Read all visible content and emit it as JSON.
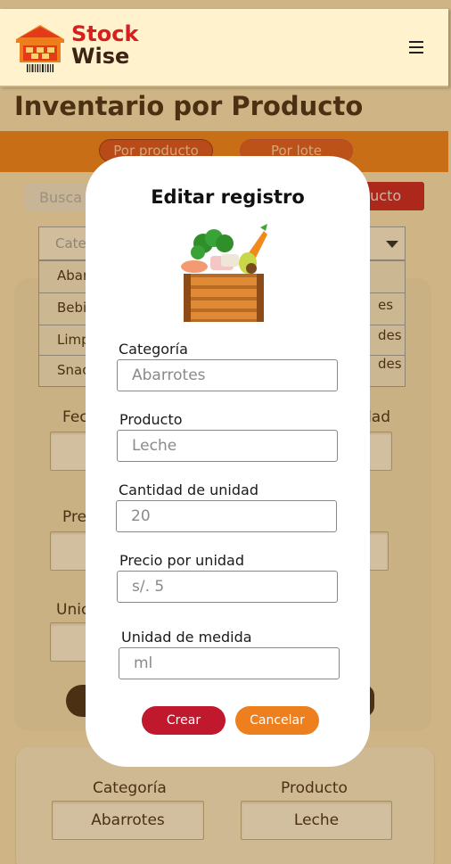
{
  "header": {
    "brand_line1": "Stock",
    "brand_line2": "Wise",
    "menu_icon": "hamburger-icon",
    "logo_icon": "warehouse-icon"
  },
  "page": {
    "title": "Inventario por Producto",
    "tabs": [
      {
        "label": "Por producto"
      },
      {
        "label": "Por lote"
      }
    ],
    "search_placeholder": "Busca",
    "add_button_label": "ducto",
    "category_dropdown_placeholder": "Cate",
    "dropdown_items": [
      {
        "label": "Abar"
      },
      {
        "label": "Bebi",
        "right": "es"
      },
      {
        "label": "Limp",
        "right": "des"
      },
      {
        "label": "Snac",
        "right": "des"
      }
    ],
    "card_labels": {
      "fecha": "Fec",
      "cantidad": "dad",
      "precio": "Pre",
      "unidad": "Unic"
    },
    "bottom_card": {
      "categoria_label": "Categoría",
      "producto_label": "Producto",
      "categoria_value": "Abarrotes",
      "producto_value": "Leche"
    }
  },
  "modal": {
    "title": "Editar registro",
    "image_icon": "vegetable-crate-icon",
    "fields": {
      "categoria": {
        "label": "Categoría",
        "placeholder": "Abarrotes"
      },
      "producto": {
        "label": "Producto",
        "placeholder": "Leche"
      },
      "cantidad": {
        "label": "Cantidad de unidad",
        "placeholder": "20"
      },
      "precio": {
        "label": "Precio por unidad",
        "placeholder": "s/. 5"
      },
      "unidad": {
        "label": "Unidad de medida",
        "placeholder": "ml"
      }
    },
    "create_label": "Crear",
    "cancel_label": "Cancelar"
  },
  "colors": {
    "accent_red": "#c0182c",
    "accent_orange": "#ee7f1f",
    "brown": "#3b2413"
  }
}
